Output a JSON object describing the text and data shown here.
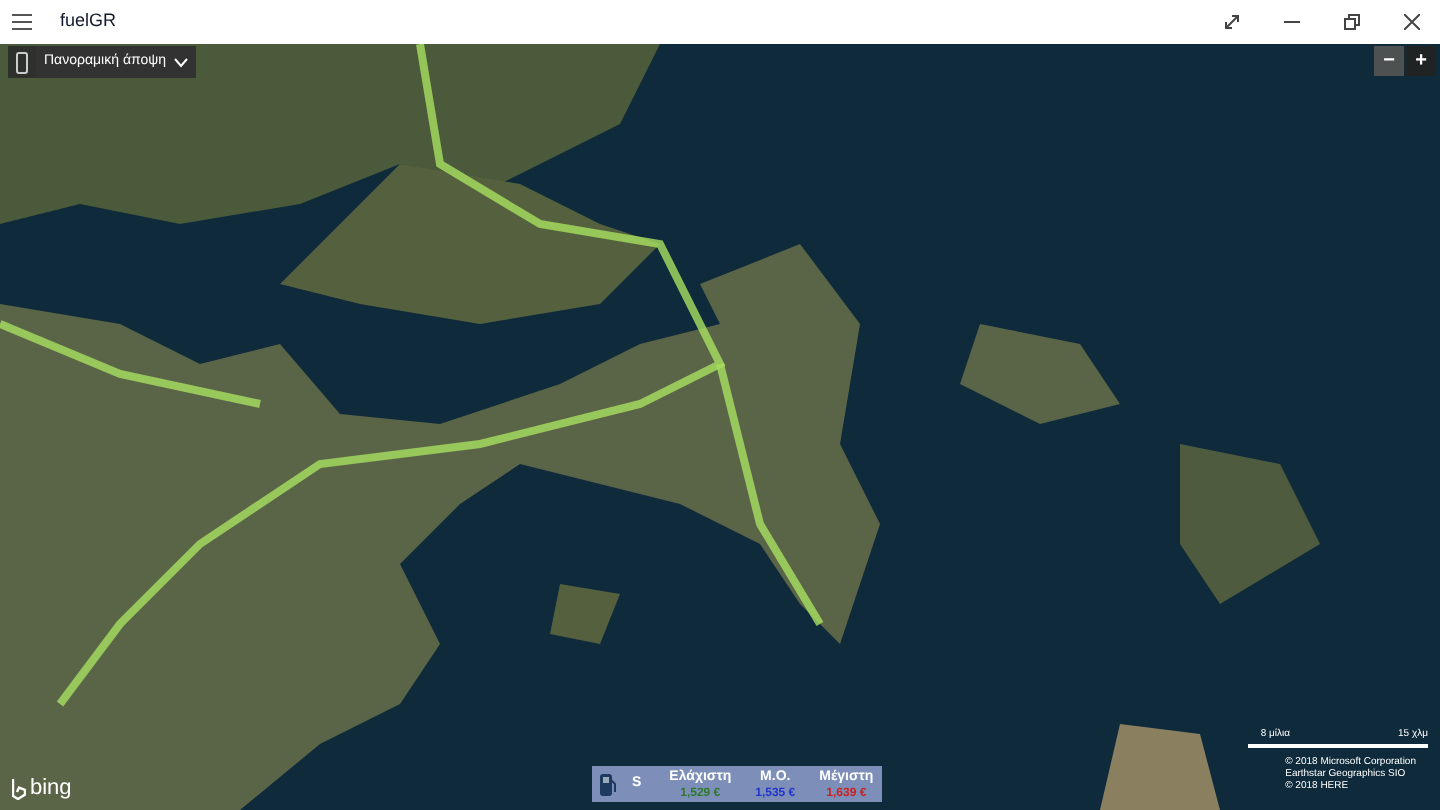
{
  "window": {
    "title": "fuelGR"
  },
  "view_selector": {
    "value": "Πανοραμική άποψη"
  },
  "zoom_buttons": [
    "−",
    "+"
  ],
  "price_panel": {
    "fuel": "S",
    "columns": [
      {
        "kind": "min",
        "heading": "Ελάχιστη",
        "value": "1,529 €"
      },
      {
        "kind": "avg",
        "heading": "Μ.Ο.",
        "value": "1,535 €"
      },
      {
        "kind": "max",
        "heading": "Μέγιστη",
        "value": "1,639 €"
      }
    ]
  },
  "scale": {
    "miles": "8 μίλια",
    "km": "15 χλμ"
  },
  "attribution": [
    "© 2018 Microsoft Corporation",
    "Earthstar Geographics SIO",
    "© 2018 HERE"
  ],
  "map_logo": "bing"
}
